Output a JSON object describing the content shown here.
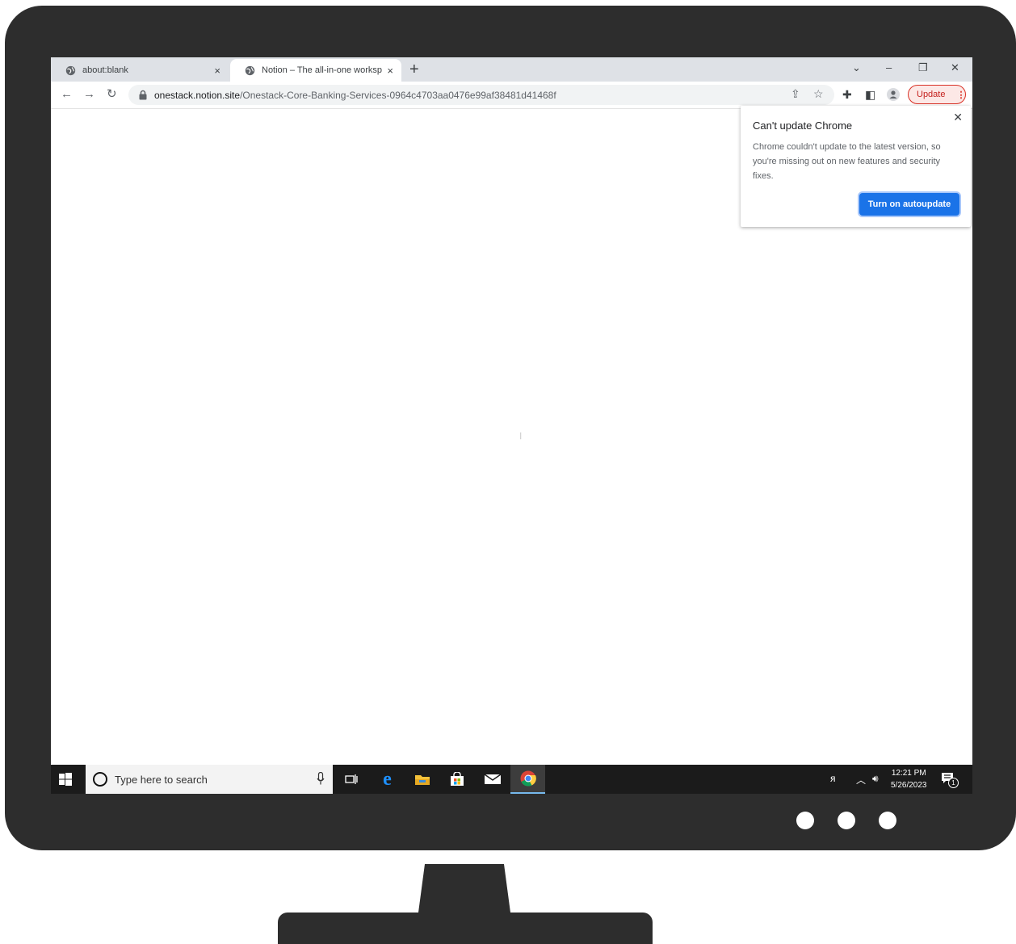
{
  "browser": {
    "tabs": [
      {
        "title": "about:blank",
        "close": "×"
      },
      {
        "title": "Notion – The all-in-one workspace",
        "close": "×"
      }
    ],
    "new_tab": "+",
    "window_controls": {
      "chevron": "⌄",
      "minimize": "–",
      "restore": "❐",
      "close": "✕"
    },
    "url": {
      "domain": "onestack.notion.site",
      "path": "/Onestack-Core-Banking-Services-0964c4703aa0476e99af38481d41468f"
    },
    "update_button": "Update",
    "update_menu": "⋮"
  },
  "popup": {
    "title": "Can't update Chrome",
    "body": "Chrome couldn't update to the latest version, so you're missing out on new features and security fixes.",
    "button": "Turn on autoupdate",
    "close": "✕"
  },
  "taskbar": {
    "search_placeholder": "Type here to search",
    "time": "12:21 PM",
    "date": "5/26/2023",
    "notifications": "1"
  },
  "colors": {
    "accent": "#1a73e8",
    "update_red": "#d93025",
    "frame": "#2d2d2d",
    "taskbar": "#1b1b1b"
  }
}
